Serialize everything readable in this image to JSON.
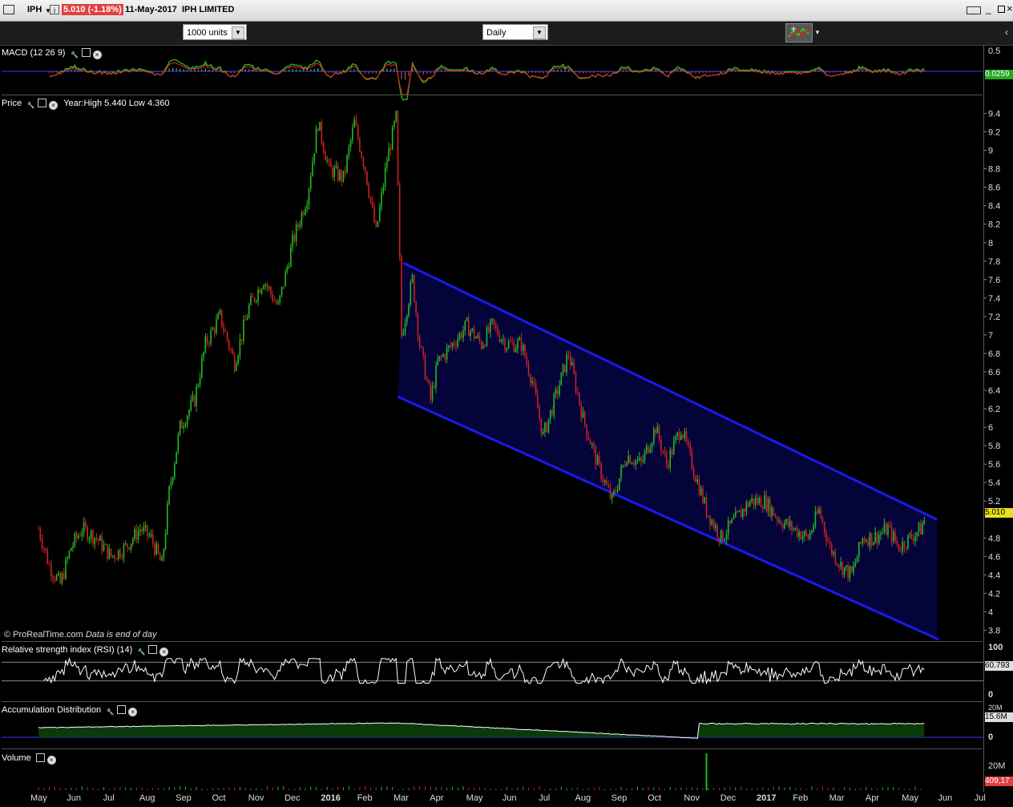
{
  "window": {
    "symbol": "IPH",
    "price_change": "5.010 (-1.18%)",
    "date": "11-May-2017",
    "name": "IPH LIMITED"
  },
  "toolbar": {
    "units_value": "1000 units",
    "period_value": "Daily"
  },
  "macd": {
    "label": "MACD (12 26 9)",
    "top_tick": "0.5",
    "current_value": "0.0259"
  },
  "price_panel": {
    "label": "Price",
    "year_info": "Year:High 5.440 Low 4.360",
    "current_price": "5.010",
    "footer": "© ProRealTime.com",
    "footer_note": "Data is end of day"
  },
  "rsi": {
    "label": "Relative strength index (RSI) (14)",
    "tick_top": "100",
    "tick_bottom": "0",
    "current_value": "60.793"
  },
  "ad": {
    "label": "Accumulation Distribution",
    "tick_top": "20M",
    "tick_zero": "0",
    "current_value": "15.6M"
  },
  "volume": {
    "label": "Volume",
    "tick": "20M",
    "current_value": "409,17"
  },
  "colors": {
    "up": "#22bb22",
    "down": "#cc2222",
    "channel": "#1a1aee",
    "channel_fill": "#04043a"
  },
  "chart_data": {
    "type": "candlestick",
    "y_ticks": [
      "9.4",
      "9.2",
      "9",
      "8.8",
      "8.6",
      "8.4",
      "8.2",
      "8",
      "7.8",
      "7.6",
      "7.4",
      "7.2",
      "7",
      "6.8",
      "6.6",
      "6.4",
      "6.2",
      "6",
      "5.8",
      "5.6",
      "5.4",
      "5.2",
      "4.8",
      "4.6",
      "4.4",
      "4.2",
      "4",
      "3.8"
    ],
    "x_ticks": [
      {
        "label": "May",
        "bold": false
      },
      {
        "label": "Jun",
        "bold": false
      },
      {
        "label": "Jul",
        "bold": false
      },
      {
        "label": "Aug",
        "bold": false
      },
      {
        "label": "Sep",
        "bold": false
      },
      {
        "label": "Oct",
        "bold": false
      },
      {
        "label": "Nov",
        "bold": false
      },
      {
        "label": "Dec",
        "bold": false
      },
      {
        "label": "2016",
        "bold": true
      },
      {
        "label": "Feb",
        "bold": false
      },
      {
        "label": "Mar",
        "bold": false
      },
      {
        "label": "Apr",
        "bold": false
      },
      {
        "label": "May",
        "bold": false
      },
      {
        "label": "Jun",
        "bold": false
      },
      {
        "label": "Jul",
        "bold": false
      },
      {
        "label": "Aug",
        "bold": false
      },
      {
        "label": "Sep",
        "bold": false
      },
      {
        "label": "Oct",
        "bold": false
      },
      {
        "label": "Nov",
        "bold": false
      },
      {
        "label": "Dec",
        "bold": false
      },
      {
        "label": "2017",
        "bold": true
      },
      {
        "label": "Feb",
        "bold": false
      },
      {
        "label": "Mar",
        "bold": false
      },
      {
        "label": "Apr",
        "bold": false
      },
      {
        "label": "May",
        "bold": false
      },
      {
        "label": "Jun",
        "bold": false
      },
      {
        "label": "Jul",
        "bold": false
      }
    ],
    "ylim": [
      3.7,
      9.5
    ],
    "close_path": [
      [
        0,
        4.9
      ],
      [
        0.3,
        4.5
      ],
      [
        0.6,
        4.3
      ],
      [
        0.9,
        4.7
      ],
      [
        1.2,
        4.9
      ],
      [
        1.6,
        4.8
      ],
      [
        2.0,
        4.6
      ],
      [
        2.4,
        4.7
      ],
      [
        2.8,
        4.9
      ],
      [
        3.1,
        4.8
      ],
      [
        3.4,
        4.5
      ],
      [
        3.6,
        5.3
      ],
      [
        3.9,
        6.0
      ],
      [
        4.3,
        6.3
      ],
      [
        4.6,
        6.9
      ],
      [
        5.0,
        7.2
      ],
      [
        5.4,
        6.7
      ],
      [
        5.8,
        7.3
      ],
      [
        6.2,
        7.6
      ],
      [
        6.6,
        7.3
      ],
      [
        7.0,
        8.0
      ],
      [
        7.4,
        8.5
      ],
      [
        7.7,
        9.3
      ],
      [
        8.0,
        8.8
      ],
      [
        8.4,
        8.7
      ],
      [
        8.7,
        9.3
      ],
      [
        9.0,
        8.8
      ],
      [
        9.3,
        8.1
      ],
      [
        9.6,
        8.9
      ],
      [
        9.85,
        9.35
      ],
      [
        10.0,
        7.0
      ],
      [
        10.3,
        7.6
      ],
      [
        10.5,
        6.9
      ],
      [
        10.8,
        6.3
      ],
      [
        11.0,
        6.7
      ],
      [
        11.4,
        6.9
      ],
      [
        11.8,
        7.1
      ],
      [
        12.2,
        6.9
      ],
      [
        12.5,
        7.1
      ],
      [
        12.9,
        6.9
      ],
      [
        13.3,
        6.9
      ],
      [
        13.6,
        6.5
      ],
      [
        13.9,
        5.9
      ],
      [
        14.3,
        6.4
      ],
      [
        14.6,
        6.8
      ],
      [
        15.0,
        6.1
      ],
      [
        15.4,
        5.6
      ],
      [
        15.8,
        5.2
      ],
      [
        16.2,
        5.7
      ],
      [
        16.6,
        5.6
      ],
      [
        17.0,
        6.0
      ],
      [
        17.3,
        5.6
      ],
      [
        17.7,
        6.0
      ],
      [
        18.0,
        5.6
      ],
      [
        18.4,
        5.1
      ],
      [
        18.8,
        4.8
      ],
      [
        19.2,
        5.0
      ],
      [
        19.6,
        5.2
      ],
      [
        20.0,
        5.2
      ],
      [
        20.4,
        5.0
      ],
      [
        20.8,
        4.9
      ],
      [
        21.2,
        4.8
      ],
      [
        21.5,
        5.1
      ],
      [
        21.8,
        4.7
      ],
      [
        22.1,
        4.5
      ],
      [
        22.4,
        4.4
      ],
      [
        22.7,
        4.8
      ],
      [
        23.0,
        4.8
      ],
      [
        23.4,
        4.9
      ],
      [
        23.7,
        4.7
      ],
      [
        24.0,
        4.8
      ],
      [
        24.3,
        4.9
      ],
      [
        24.45,
        5.04
      ]
    ],
    "channel": {
      "upper": [
        [
          10.05,
          7.78
        ],
        [
          24.75,
          5.0
        ]
      ],
      "lower": [
        [
          9.9,
          6.33
        ],
        [
          24.8,
          3.7
        ]
      ]
    }
  }
}
